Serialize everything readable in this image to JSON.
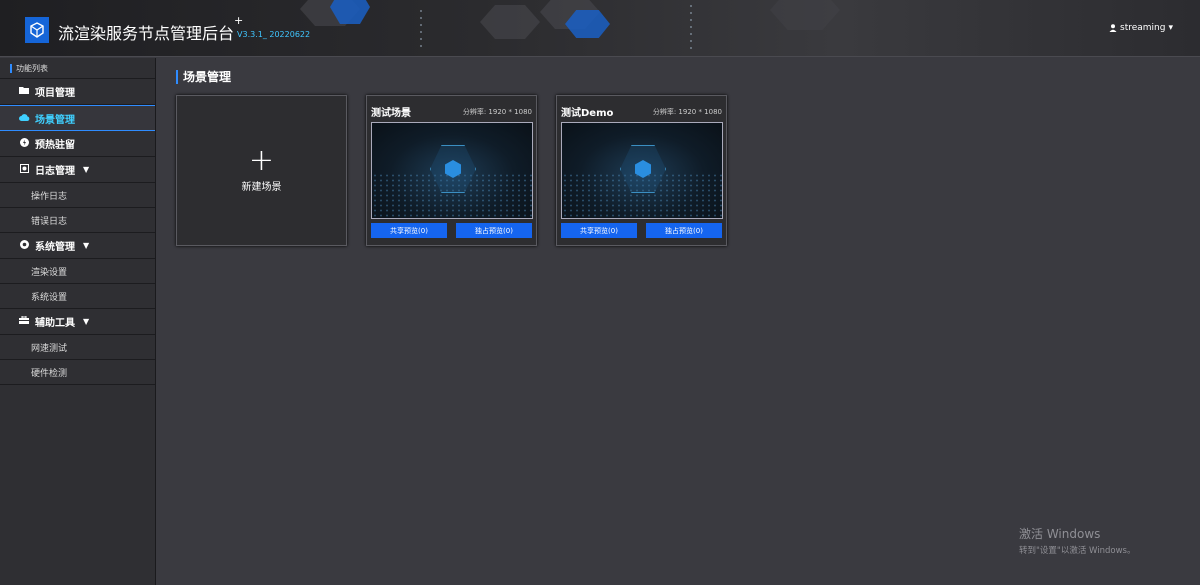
{
  "header": {
    "title": "流渲染服务节点管理后台",
    "plus_mark": "+",
    "version": "V3.3.1_ 20220622",
    "user": "streaming",
    "user_icon": "user-icon",
    "caret": "▾"
  },
  "sidebar": {
    "heading": "功能列表",
    "items": [
      {
        "label": "项目管理",
        "icon": "folder-icon"
      },
      {
        "label": "场景管理",
        "icon": "cloud-icon"
      },
      {
        "label": "预热驻留",
        "icon": "power-icon"
      },
      {
        "label": "日志管理",
        "icon": "log-icon"
      },
      {
        "label": "操作日志"
      },
      {
        "label": "错误日志"
      },
      {
        "label": "系统管理",
        "icon": "gear-icon"
      },
      {
        "label": "渲染设置"
      },
      {
        "label": "系统设置"
      },
      {
        "label": "辅助工具",
        "icon": "toolbox-icon"
      },
      {
        "label": "网速测试"
      },
      {
        "label": "硬件检测"
      }
    ]
  },
  "main": {
    "title": "场景管理",
    "new_scene": {
      "plus": "+",
      "label": "新建场景"
    },
    "scenes": [
      {
        "name": "测试场景",
        "resolution": "分辨率: 1920 * 1080",
        "share_btn": "共享预览(0)",
        "exclusive_btn": "独占预览(0)"
      },
      {
        "name": "测试Demo",
        "resolution": "分辨率: 1920 * 1080",
        "share_btn": "共享预览(0)",
        "exclusive_btn": "独占预览(0)"
      }
    ]
  },
  "watermark": {
    "line1": "激活 Windows",
    "line2": "转到\"设置\"以激活 Windows。"
  }
}
